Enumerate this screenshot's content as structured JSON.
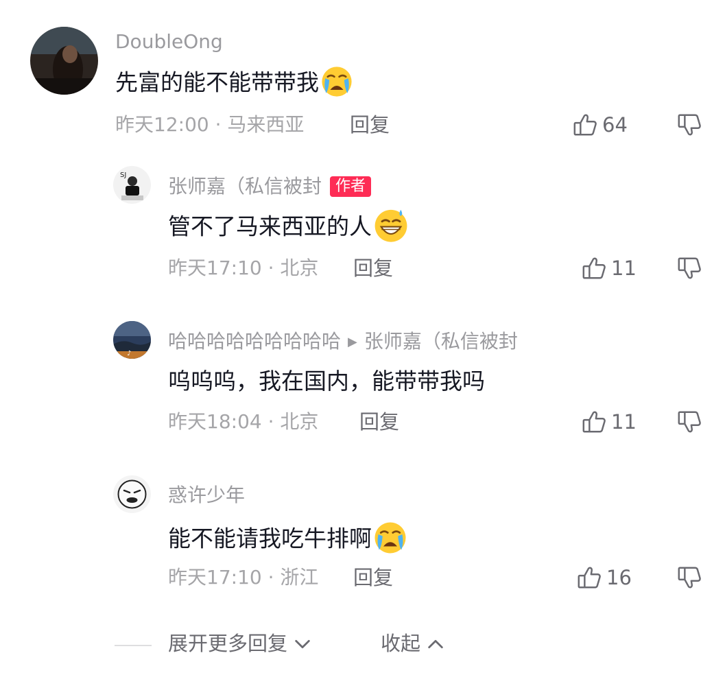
{
  "comment": {
    "username": "DoubleOng",
    "text": "先富的能不能带带我",
    "emoji": "crying-face",
    "time": "昨天12:00",
    "location": "马来西亚",
    "reply_label": "回复",
    "likes": "64"
  },
  "replies": [
    {
      "username": "张师嘉（私信被封",
      "badge": "作者",
      "text": "管不了马来西亚的人",
      "emoji": "grinning-sweat-face",
      "time": "昨天17:10",
      "location": "北京",
      "reply_label": "回复",
      "likes": "11"
    },
    {
      "username": "哈哈哈哈哈哈哈哈哈",
      "reply_to": "张师嘉（私信被封",
      "text": "呜呜呜，我在国内，能带带我吗",
      "time": "昨天18:04",
      "location": "北京",
      "reply_label": "回复",
      "likes": "11"
    },
    {
      "username": "惑许少年",
      "text": "能不能请我吃牛排啊",
      "emoji": "crying-face",
      "time": "昨天17:10",
      "location": "浙江",
      "reply_label": "回复",
      "likes": "16"
    }
  ],
  "footer": {
    "expand_label": "展开更多回复",
    "collapse_label": "收起"
  },
  "colors": {
    "accent": "#fe2c55",
    "username": "#9a9a9e",
    "text": "#161823",
    "meta": "#a5a5a8"
  }
}
